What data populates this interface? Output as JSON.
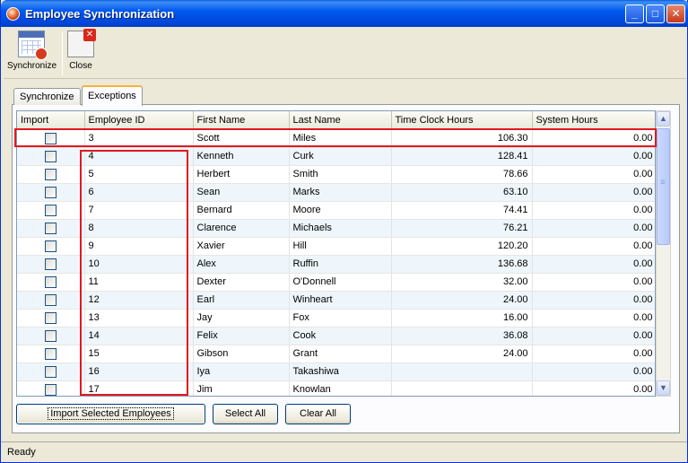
{
  "window": {
    "title": "Employee Synchronization",
    "minimize": "_",
    "maximize": "□",
    "close": "✕"
  },
  "toolbar": {
    "synchronize_label": "Synchronize",
    "close_label": "Close"
  },
  "tabs": [
    {
      "label": "Synchronize",
      "active": false
    },
    {
      "label": "Exceptions",
      "active": true
    }
  ],
  "grid": {
    "columns": [
      "Import",
      "Employee ID",
      "First Name",
      "Last Name",
      "Time Clock Hours",
      "System Hours"
    ],
    "rows": [
      {
        "import": false,
        "id": "3",
        "first": "Scott",
        "last": "Miles",
        "clock": "106.30",
        "system": "0.00"
      },
      {
        "import": false,
        "id": "4",
        "first": "Kenneth",
        "last": "Curk",
        "clock": "128.41",
        "system": "0.00"
      },
      {
        "import": false,
        "id": "5",
        "first": "Herbert",
        "last": "Smith",
        "clock": "78.66",
        "system": "0.00"
      },
      {
        "import": false,
        "id": "6",
        "first": "Sean",
        "last": "Marks",
        "clock": "63.10",
        "system": "0.00"
      },
      {
        "import": false,
        "id": "7",
        "first": "Bernard",
        "last": "Moore",
        "clock": "74.41",
        "system": "0.00"
      },
      {
        "import": false,
        "id": "8",
        "first": "Clarence",
        "last": "Michaels",
        "clock": "76.21",
        "system": "0.00"
      },
      {
        "import": false,
        "id": "9",
        "first": "Xavier",
        "last": "Hill",
        "clock": "120.20",
        "system": "0.00"
      },
      {
        "import": false,
        "id": "10",
        "first": "Alex",
        "last": "Ruffin",
        "clock": "136.68",
        "system": "0.00"
      },
      {
        "import": false,
        "id": "11",
        "first": "Dexter",
        "last": "O'Donnell",
        "clock": "32.00",
        "system": "0.00"
      },
      {
        "import": false,
        "id": "12",
        "first": "Earl",
        "last": "Winheart",
        "clock": "24.00",
        "system": "0.00"
      },
      {
        "import": false,
        "id": "13",
        "first": "Jay",
        "last": "Fox",
        "clock": "16.00",
        "system": "0.00"
      },
      {
        "import": false,
        "id": "14",
        "first": "Felix",
        "last": "Cook",
        "clock": "36.08",
        "system": "0.00"
      },
      {
        "import": false,
        "id": "15",
        "first": "Gibson",
        "last": "Grant",
        "clock": "24.00",
        "system": "0.00"
      },
      {
        "import": false,
        "id": "16",
        "first": "Iya",
        "last": "Takashiwa",
        "clock": "",
        "system": "0.00"
      },
      {
        "import": false,
        "id": "17",
        "first": "Jim",
        "last": "Knowlan",
        "clock": "",
        "system": "0.00"
      }
    ]
  },
  "buttons": {
    "import_selected": "Import Selected Employees",
    "select_all": "Select All",
    "clear_all": "Clear All"
  },
  "status": "Ready",
  "colors": {
    "title_bar": "#0054e3",
    "highlight": "#e0191f",
    "alt_row": "#eef6fb"
  }
}
